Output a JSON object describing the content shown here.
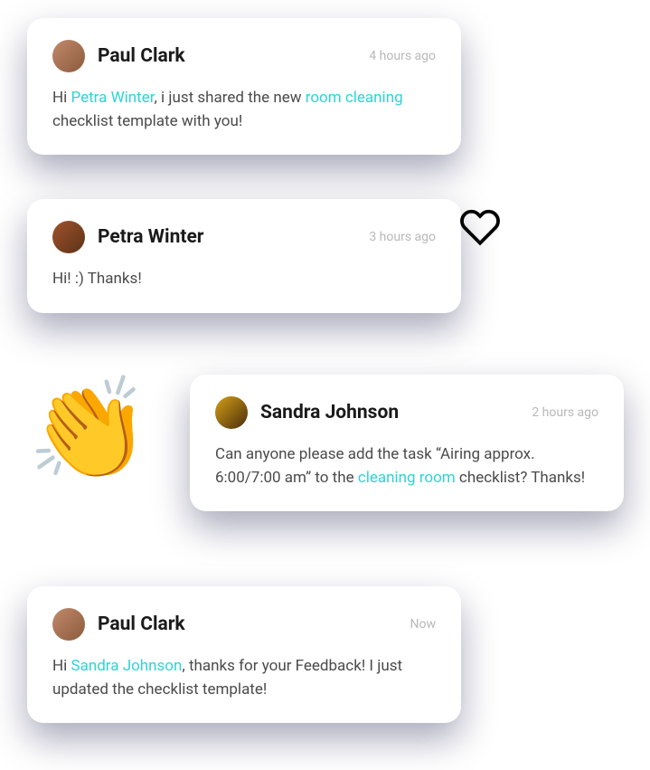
{
  "colors": {
    "mention": "#2dd4d4"
  },
  "decorations": {
    "clap_emoji": "👏",
    "heart_icon": "heart-outline"
  },
  "messages": [
    {
      "author": "Paul Clark",
      "avatar_class": "paul",
      "timestamp": "4 hours ago",
      "segments": [
        {
          "type": "text",
          "value": "Hi "
        },
        {
          "type": "mention",
          "value": "Petra Winter"
        },
        {
          "type": "text",
          "value": ", i just shared the new "
        },
        {
          "type": "link",
          "value": "room cleaning"
        },
        {
          "type": "text",
          "value": " checklist template with you!"
        }
      ]
    },
    {
      "author": "Petra Winter",
      "avatar_class": "petra",
      "timestamp": "3 hours ago",
      "segments": [
        {
          "type": "text",
          "value": "Hi! :) Thanks!"
        }
      ]
    },
    {
      "author": "Sandra Johnson",
      "avatar_class": "sandra",
      "timestamp": "2 hours ago",
      "segments": [
        {
          "type": "text",
          "value": "Can anyone please add the task “Airing approx. 6:00/7:00 am” to the "
        },
        {
          "type": "link",
          "value": "cleaning room"
        },
        {
          "type": "text",
          "value": " checklist? Thanks!"
        }
      ]
    },
    {
      "author": "Paul Clark",
      "avatar_class": "paul",
      "timestamp": "Now",
      "segments": [
        {
          "type": "text",
          "value": "Hi "
        },
        {
          "type": "mention",
          "value": "Sandra Johnson"
        },
        {
          "type": "text",
          "value": ", thanks for your Feedback! I just updated the checklist template!"
        }
      ]
    }
  ]
}
